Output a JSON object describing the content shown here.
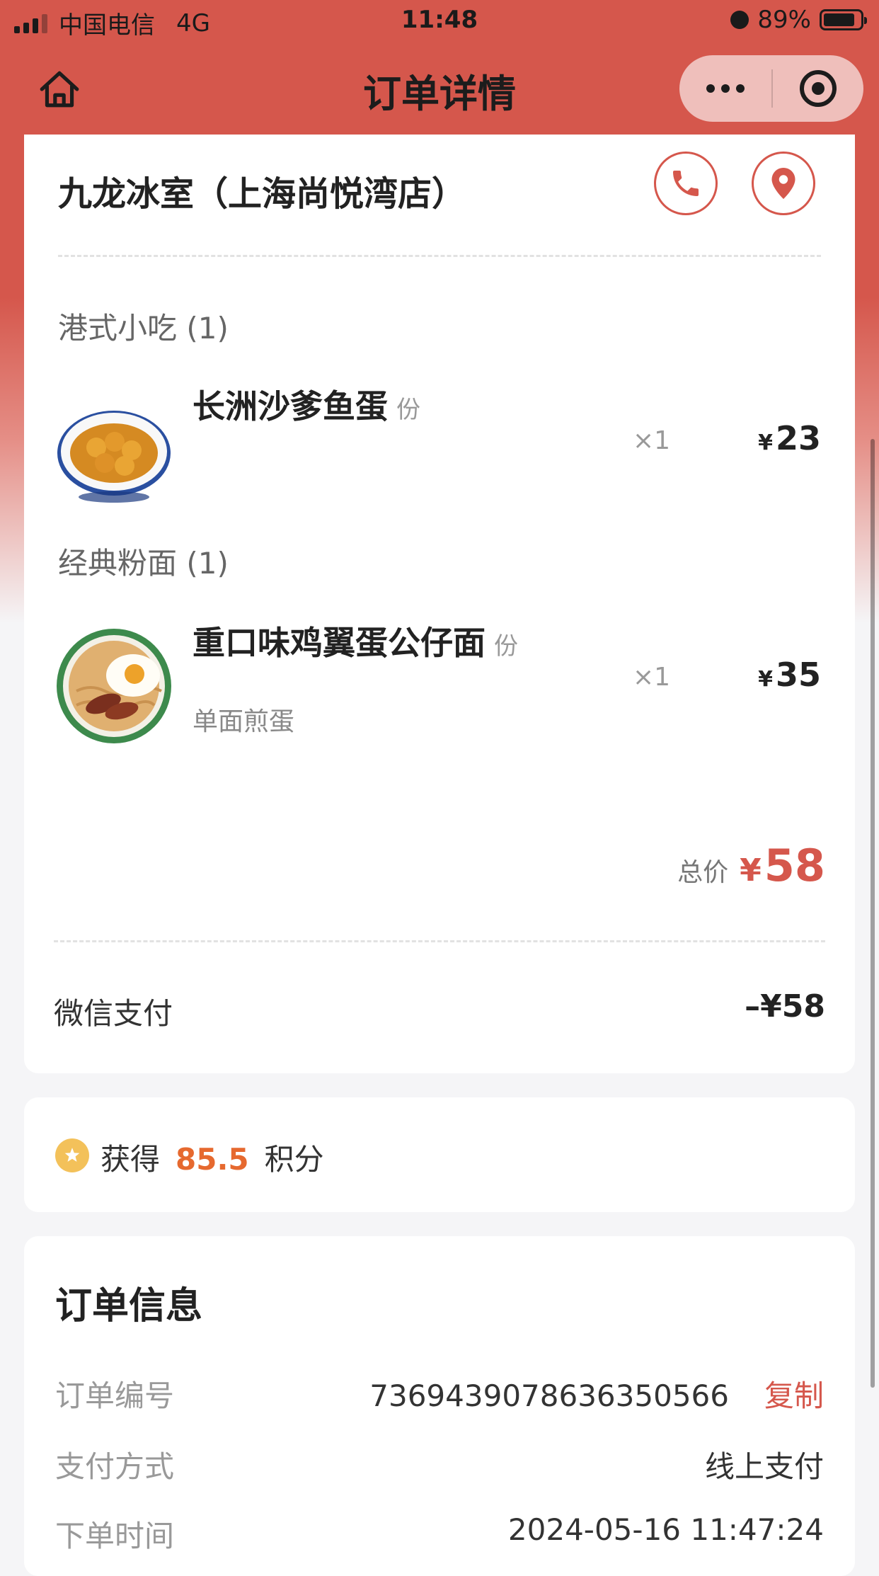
{
  "status_bar": {
    "carrier": "中国电信",
    "network": "4G",
    "time": "11:48",
    "battery": "89%"
  },
  "nav": {
    "title": "订单详情",
    "home_icon": "home-icon",
    "more_icon": "more-dots-icon",
    "close_icon": "target-close-icon"
  },
  "store": {
    "name": "九龙冰室（上海尚悦湾店）",
    "phone_icon": "phone-icon",
    "location_icon": "location-pin-icon"
  },
  "categories": [
    {
      "title": "港式小吃 (1)",
      "items": [
        {
          "name": "长洲沙爹鱼蛋",
          "unit": "份",
          "qty": "×1",
          "price_symbol": "¥",
          "price": "23",
          "spec": ""
        }
      ]
    },
    {
      "title": "经典粉面 (1)",
      "items": [
        {
          "name": "重口味鸡翼蛋公仔面",
          "unit": "份",
          "qty": "×1",
          "price_symbol": "¥",
          "price": "35",
          "spec": "单面煎蛋"
        }
      ]
    }
  ],
  "total": {
    "label": "总价",
    "symbol": "¥",
    "value": "58"
  },
  "payment": {
    "method": "微信支付",
    "amount": "–¥58"
  },
  "points": {
    "prefix": "获得",
    "value": "85.5",
    "suffix": "积分",
    "icon": "star-coin-icon"
  },
  "order_info": {
    "title": "订单信息",
    "rows": [
      {
        "label": "订单编号",
        "value": "7369439078636350566",
        "action": "复制"
      },
      {
        "label": "支付方式",
        "value": "线上支付"
      },
      {
        "label": "下单时间",
        "value": "2024-05-16 11:47:24"
      }
    ]
  },
  "colors": {
    "accent": "#d5574c",
    "points": "#e6692f",
    "coin": "#f3c15a"
  }
}
